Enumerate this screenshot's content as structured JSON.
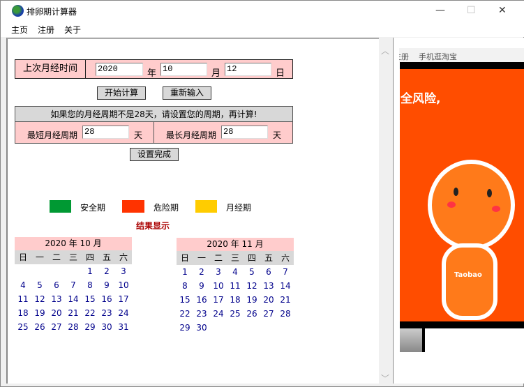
{
  "window": {
    "title": "排卵期计算器",
    "minimize": "—",
    "maximize": "☐",
    "close": "✕"
  },
  "menu": [
    "主页",
    "注册",
    "关于"
  ],
  "form": {
    "last_period_label": "上次月经时间",
    "year": "2020",
    "year_unit": "年",
    "month": "10",
    "month_unit": "月",
    "day": "12",
    "day_unit": "日",
    "start_button": "开始计算",
    "reset_button": "重新输入",
    "notice": "如果您的月经周期不是28天，请设置您的周期，再计算!",
    "min_cycle_label": "最短月经周期",
    "min_cycle": "28",
    "max_cycle_label": "最长月经周期",
    "max_cycle": "28",
    "day_label": "天",
    "done_button": "设置完成"
  },
  "legend": [
    {
      "label": "安全期",
      "color": "#009933"
    },
    {
      "label": "危险期",
      "color": "#ff3300"
    },
    {
      "label": "月经期",
      "color": "#ffcc00"
    }
  ],
  "result_title": "结果显示",
  "weekdays": [
    "日",
    "一",
    "二",
    "三",
    "四",
    "五",
    "六"
  ],
  "calendars": [
    {
      "title": "2020 年 10 月",
      "rows": [
        [
          "",
          "",
          "",
          "",
          "1",
          "2",
          "3"
        ],
        [
          "4",
          "5",
          "6",
          "7",
          "8",
          "9",
          "10"
        ],
        [
          "11",
          "12",
          "13",
          "14",
          "15",
          "16",
          "17"
        ],
        [
          "18",
          "19",
          "20",
          "21",
          "22",
          "23",
          "24"
        ],
        [
          "25",
          "26",
          "27",
          "28",
          "29",
          "30",
          "31"
        ]
      ]
    },
    {
      "title": "2020 年 11 月",
      "rows": [
        [
          "1",
          "2",
          "3",
          "4",
          "5",
          "6",
          "7"
        ],
        [
          "8",
          "9",
          "10",
          "11",
          "12",
          "13",
          "14"
        ],
        [
          "15",
          "16",
          "17",
          "18",
          "19",
          "20",
          "21"
        ],
        [
          "22",
          "23",
          "24",
          "25",
          "26",
          "27",
          "28"
        ],
        [
          "29",
          "30",
          "",
          "",
          "",
          "",
          ""
        ]
      ]
    }
  ],
  "ad": {
    "nav": "注册    手机逛淘宝",
    "headline": "全风险,",
    "mascot_text": "Taobao"
  }
}
